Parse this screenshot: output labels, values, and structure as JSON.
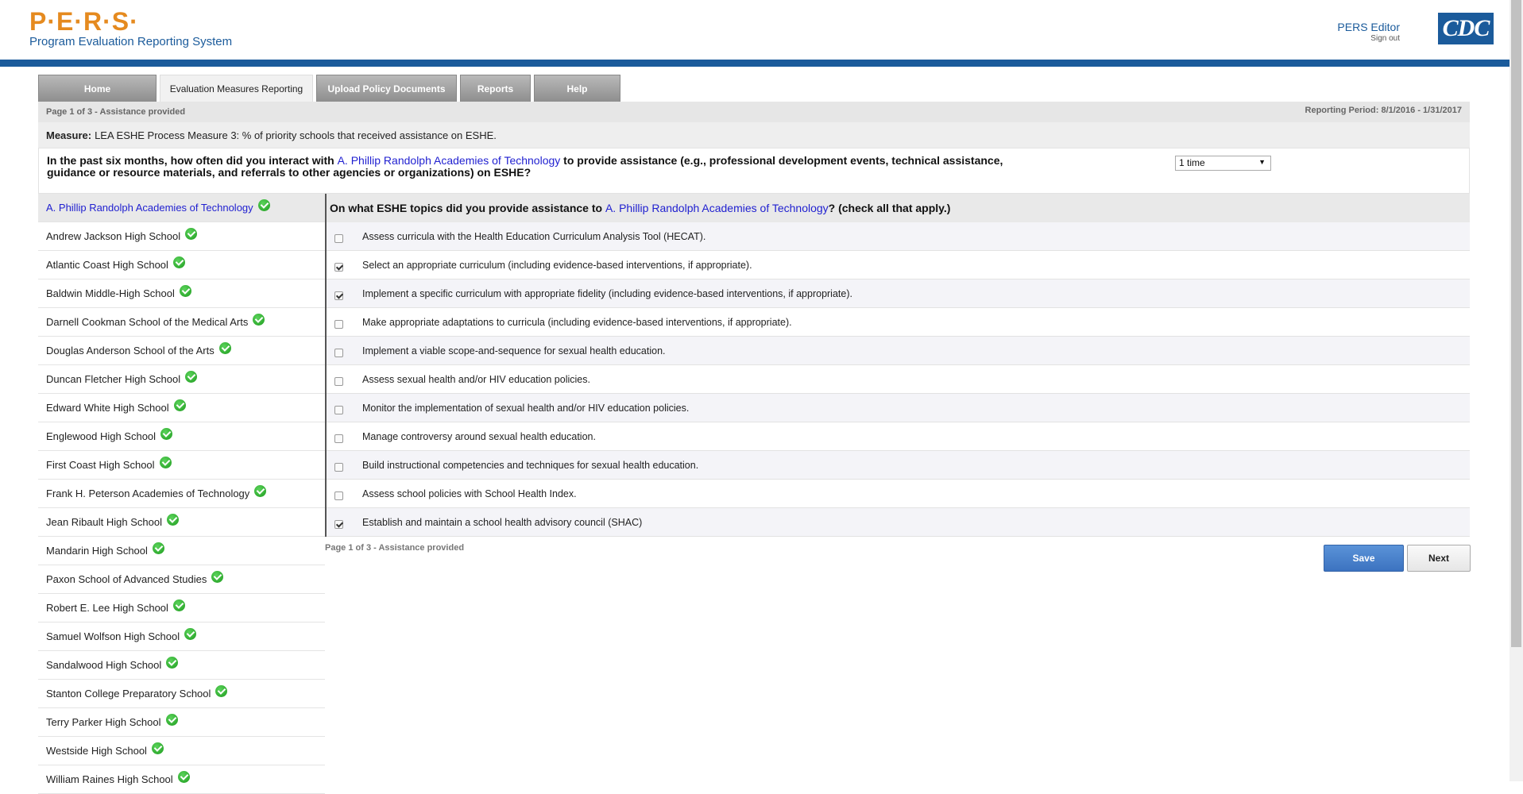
{
  "header": {
    "logo_text": "P·E·R·S·",
    "logo_subtitle": "Program Evaluation Reporting System",
    "user_name": "PERS Editor",
    "sign_out": "Sign out",
    "cdc_logo": "CDC"
  },
  "tabs": [
    {
      "label": "Home",
      "active": false
    },
    {
      "label": "Evaluation Measures Reporting",
      "active": true
    },
    {
      "label": "Upload Policy Documents",
      "active": false
    },
    {
      "label": "Reports",
      "active": false
    },
    {
      "label": "Help",
      "active": false
    }
  ],
  "pager": {
    "top": "Page 1 of 3 - Assistance provided",
    "bottom": "Page 1 of 3 - Assistance provided",
    "reporting_period": "Reporting Period: 8/1/2016 - 1/31/2017"
  },
  "measure": {
    "label": "Measure:",
    "text": "LEA ESHE Process Measure 3: % of priority schools that received assistance on ESHE."
  },
  "question": {
    "prefix": "In the past six months, how often did you interact with ",
    "school": "A. Phillip Randolph Academies of Technology",
    "suffix": " to provide assistance (e.g., professional development events, technical assistance, guidance or resource materials, and referrals to other agencies or organizations) on ESHE?",
    "selected_value": "1 time"
  },
  "topics_header": {
    "prefix": "On what ESHE topics did you provide assistance to ",
    "school": "A. Phillip Randolph Academies of Technology",
    "suffix": "? (check all that apply.)"
  },
  "schools": [
    {
      "name": "A. Phillip Randolph Academies of Technology",
      "active": true
    },
    {
      "name": "Andrew Jackson High School",
      "active": false
    },
    {
      "name": "Atlantic Coast High School",
      "active": false
    },
    {
      "name": "Baldwin Middle-High School",
      "active": false
    },
    {
      "name": "Darnell Cookman School of the Medical Arts",
      "active": false
    },
    {
      "name": "Douglas Anderson School of the Arts",
      "active": false
    },
    {
      "name": "Duncan Fletcher High School",
      "active": false
    },
    {
      "name": "Edward White High School",
      "active": false
    },
    {
      "name": "Englewood High School",
      "active": false
    },
    {
      "name": "First Coast High School",
      "active": false
    },
    {
      "name": "Frank H. Peterson Academies of Technology",
      "active": false
    },
    {
      "name": "Jean Ribault High School",
      "active": false
    },
    {
      "name": "Mandarin High School",
      "active": false
    },
    {
      "name": "Paxon School of Advanced Studies",
      "active": false
    },
    {
      "name": "Robert E. Lee High School",
      "active": false
    },
    {
      "name": "Samuel Wolfson High School",
      "active": false
    },
    {
      "name": "Sandalwood High School",
      "active": false
    },
    {
      "name": "Stanton College Preparatory School",
      "active": false
    },
    {
      "name": "Terry Parker High School",
      "active": false
    },
    {
      "name": "Westside High School",
      "active": false
    },
    {
      "name": "William Raines High School",
      "active": false
    }
  ],
  "topics": [
    {
      "label": "Assess curricula with the Health Education Curriculum Analysis Tool (HECAT).",
      "checked": false
    },
    {
      "label": "Select an appropriate curriculum (including evidence-based interventions, if appropriate).",
      "checked": true
    },
    {
      "label": "Implement a specific curriculum with appropriate fidelity (including evidence-based interventions, if appropriate).",
      "checked": true
    },
    {
      "label": "Make appropriate adaptations to curricula (including evidence-based interventions, if appropriate).",
      "checked": false
    },
    {
      "label": "Implement a viable scope-and-sequence for sexual health education.",
      "checked": false
    },
    {
      "label": "Assess sexual health and/or HIV education policies.",
      "checked": false
    },
    {
      "label": "Monitor the implementation of sexual health and/or HIV education policies.",
      "checked": false
    },
    {
      "label": "Manage controversy around sexual health education.",
      "checked": false
    },
    {
      "label": "Build instructional competencies and techniques for sexual health education.",
      "checked": false
    },
    {
      "label": "Assess school policies with School Health Index.",
      "checked": false
    },
    {
      "label": "Establish and maintain a school health advisory council (SHAC)",
      "checked": true
    }
  ],
  "buttons": {
    "save": "Save",
    "next": "Next"
  }
}
